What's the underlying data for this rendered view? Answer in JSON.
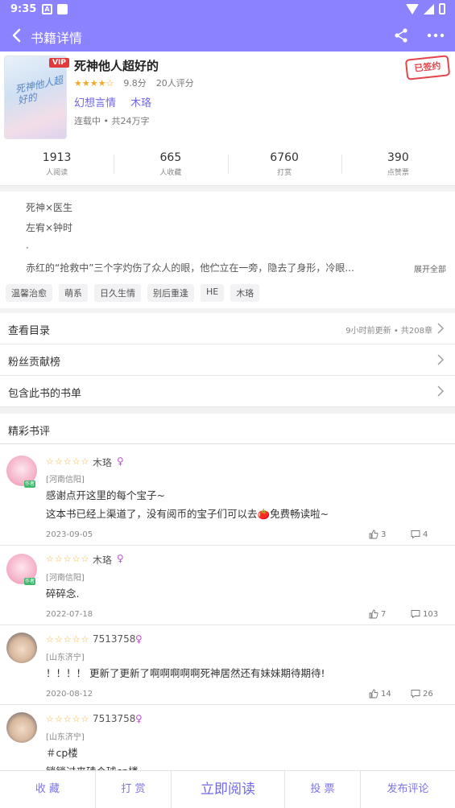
{
  "status_bar": {
    "time": "9:35",
    "icon1": "A"
  },
  "header": {
    "title": "书籍详情",
    "icons": [
      "back-arrow-icon",
      "share-icon",
      "more-icon"
    ]
  },
  "book": {
    "vip_badge": "VIP",
    "title": "死神他人超好的",
    "rating_stars": "★★★★☆",
    "rating": "9.8分",
    "rating_count": "20人评分",
    "category": "幻想言情",
    "author": "木珞",
    "status": "连载中 • 共24万字",
    "signed_stamp": "已签约",
    "cover_text": "死神他人超好的"
  },
  "stats": [
    {
      "value": "1913",
      "label": "人阅读"
    },
    {
      "value": "665",
      "label": "人收藏"
    },
    {
      "value": "6760",
      "label": "打赏"
    },
    {
      "value": "390",
      "label": "点赞票"
    }
  ],
  "description": {
    "lines": [
      "死神×医生",
      "左宥×钟时",
      "·",
      "赤红的“抢救中”三个字灼伤了众人的眼，他伫立在一旁，隐去了身形，冷眼..."
    ],
    "expand_label": "展开全部"
  },
  "tags": [
    "温馨治愈",
    "萌系",
    "日久生情",
    "别后重逢",
    "HE",
    "木珞"
  ],
  "menu": [
    {
      "label": "查看目录",
      "extra": "9小时前更新 • 共208章"
    },
    {
      "label": "粉丝贡献榜",
      "extra": ""
    },
    {
      "label": "包含此书的书单",
      "extra": ""
    }
  ],
  "reviews_title": "精彩书评",
  "reviews": [
    {
      "stars": "☆☆☆☆☆",
      "name": "木珞",
      "gender_icon": "♀",
      "location": "[河南信阳]",
      "lines": [
        "感谢点开这里的每个宝子~",
        "这本书已经上渠道了，没有阅币的宝子们可以去🍅免费畅读啦~"
      ],
      "date": "2023-09-05",
      "likes": "3",
      "comments": "4",
      "level": "作者"
    },
    {
      "stars": "☆☆☆☆☆",
      "name": "木珞",
      "gender_icon": "♀",
      "location": "[河南信阳]",
      "lines": [
        "碎碎念."
      ],
      "date": "2022-07-18",
      "likes": "7",
      "comments": "103",
      "level": "作者"
    },
    {
      "stars": "☆☆☆☆☆",
      "name": "7513758",
      "gender_icon": "♀",
      "location": "[山东济宁]",
      "lines": [
        "！！！！ 更新了更新了啊啊啊啊啊死神居然还有妹妹期待期待!"
      ],
      "date": "2020-08-12",
      "likes": "14",
      "comments": "26"
    },
    {
      "stars": "☆☆☆☆☆",
      "name": "7513758",
      "gender_icon": "♀",
      "location": "[山东济宁]",
      "lines": [
        "＃cp楼",
        "锁锁过来磕个球cp楼"
      ],
      "date": "",
      "likes": "",
      "comments": ""
    }
  ],
  "bottom_bar": [
    "收 藏",
    "打 赏",
    "立即阅读",
    "投 票",
    "发布评论"
  ],
  "colors": {
    "accent": "#8B82FF",
    "link": "#6F67E5",
    "star": "#F3A92A",
    "vip": "#E2393C"
  }
}
